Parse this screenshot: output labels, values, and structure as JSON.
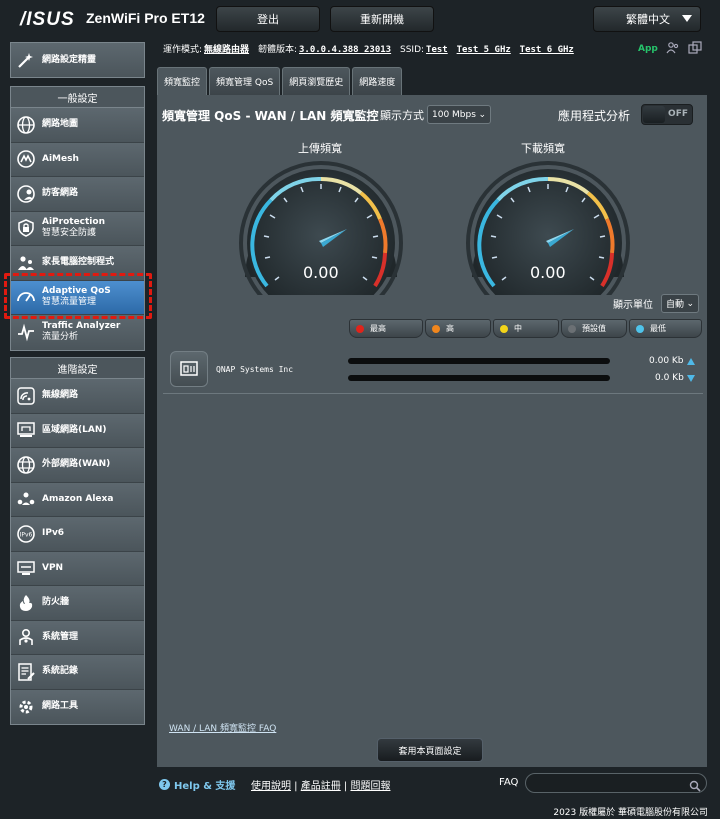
{
  "header": {
    "logo": "/ISUS",
    "model": "ZenWiFi Pro ET12",
    "logout": "登出",
    "reboot": "重新開機",
    "language": "繁體中文"
  },
  "sidebar": {
    "wizard": "網路設定精靈",
    "general_title": "一般設定",
    "general_items": [
      {
        "label": "網路地圖",
        "sub": ""
      },
      {
        "label": "AiMesh",
        "sub": ""
      },
      {
        "label": "訪客網路",
        "sub": ""
      },
      {
        "label": "AiProtection",
        "sub": "智慧安全防護"
      },
      {
        "label": "家長電腦控制程式",
        "sub": ""
      },
      {
        "label": "Adaptive QoS",
        "sub": "智慧流量管理"
      },
      {
        "label": "Traffic Analyzer",
        "sub": "流量分析"
      }
    ],
    "advanced_title": "進階設定",
    "advanced_items": [
      {
        "label": "無線網路"
      },
      {
        "label": "區域網路(LAN)"
      },
      {
        "label": "外部網路(WAN)"
      },
      {
        "label": "Amazon Alexa"
      },
      {
        "label": "IPv6"
      },
      {
        "label": "VPN"
      },
      {
        "label": "防火牆"
      },
      {
        "label": "系統管理"
      },
      {
        "label": "系統記錄"
      },
      {
        "label": "網路工具"
      }
    ]
  },
  "status": {
    "mode_label": "運作模式:",
    "mode_value": "無線路由器",
    "fw_label": "韌體版本:",
    "fw_value": "3.0.0.4.388_23013",
    "ssid_label": "SSID:",
    "ssid1": "Test",
    "ssid2": "Test_5_GHz",
    "ssid3": "Test_6_GHz",
    "app": "App"
  },
  "tabs": [
    "頻寬監控",
    "頻寬管理 QoS",
    "網頁瀏覽歷史",
    "網路速度"
  ],
  "panel": {
    "title": "頻寬管理 QoS - WAN / LAN 頻寬監控",
    "display_mode_label": "顯示方式",
    "display_mode_value": "100 Mbps",
    "app_analysis_label": "應用程式分析",
    "toggle_state": "OFF",
    "upload_label": "上傳頻寬",
    "download_label": "下載頻寬",
    "upload_value": "0.00",
    "download_value": "0.00",
    "unit_label": "顯示單位",
    "unit_value": "自動",
    "legend": [
      {
        "label": "最高",
        "color": "#e0241b"
      },
      {
        "label": "高",
        "color": "#f0861d"
      },
      {
        "label": "中",
        "color": "#f3d419"
      },
      {
        "label": "預設值",
        "color": "#6b7074"
      },
      {
        "label": "最低",
        "color": "#4fc3ea"
      }
    ],
    "client_name": "QNAP Systems Inc",
    "client_up": "0.00 Kb",
    "client_down": "0.0 Kb",
    "faq_link": "WAN / LAN 頻寬監控 FAQ",
    "apply_button": "套用本頁面設定"
  },
  "footer": {
    "help": "Help & 支援",
    "link1": "使用說明",
    "link2": "產品註冊",
    "link3": "問題回報",
    "faq": "FAQ",
    "copyright": "2023 版權屬於 華碩電腦股份有限公司"
  }
}
